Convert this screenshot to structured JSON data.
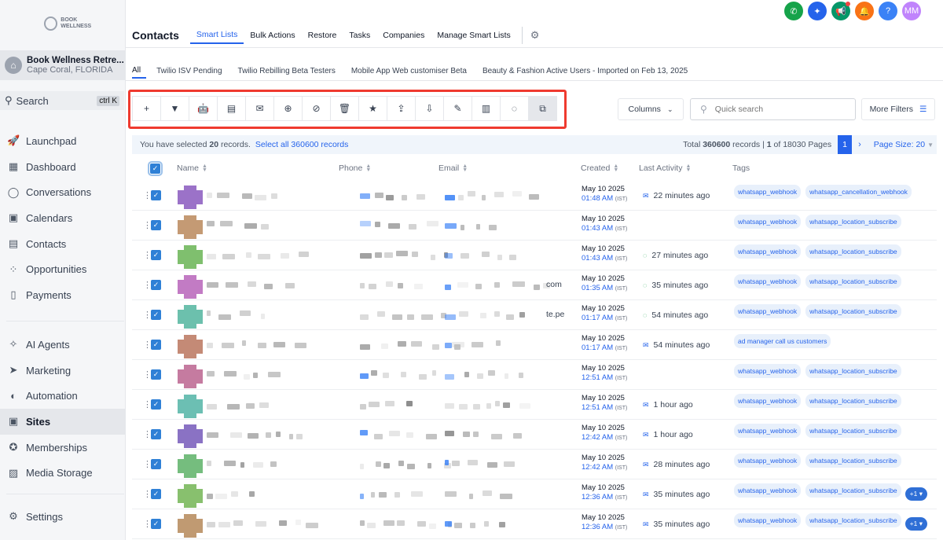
{
  "sidebar": {
    "logo_text": "BOOK WELLNESS",
    "location_name": "Book Wellness Retre...",
    "location_sub": "Cape Coral, FLORIDA",
    "search_label": "Search",
    "search_shortcut": "ctrl K",
    "items": [
      {
        "label": "Launchpad",
        "icon": "rocket-icon"
      },
      {
        "label": "Dashboard",
        "icon": "grid-icon"
      },
      {
        "label": "Conversations",
        "icon": "chat-icon"
      },
      {
        "label": "Calendars",
        "icon": "calendar-icon"
      },
      {
        "label": "Contacts",
        "icon": "contacts-icon"
      },
      {
        "label": "Opportunities",
        "icon": "funnel-icon"
      },
      {
        "label": "Payments",
        "icon": "receipt-icon"
      }
    ],
    "items2": [
      {
        "label": "AI Agents",
        "icon": "sparkle-icon"
      },
      {
        "label": "Marketing",
        "icon": "send-icon"
      },
      {
        "label": "Automation",
        "icon": "automation-icon"
      },
      {
        "label": "Sites",
        "icon": "sites-icon"
      },
      {
        "label": "Memberships",
        "icon": "membership-icon"
      },
      {
        "label": "Media Storage",
        "icon": "image-icon"
      }
    ],
    "settings_label": "Settings"
  },
  "header": {
    "avatar_initials": "MM",
    "title": "Contacts",
    "tabs": [
      "Smart Lists",
      "Bulk Actions",
      "Restore",
      "Tasks",
      "Companies",
      "Manage Smart Lists"
    ],
    "subtabs": [
      "All",
      "Twilio ISV Pending",
      "Twilio Rebilling Beta Testers",
      "Mobile App Web customiser Beta",
      "Beauty & Fashion Active Users - Imported on Feb 13, 2025"
    ]
  },
  "toolbar": {
    "columns_label": "Columns",
    "search_placeholder": "Quick search",
    "more_filters_label": "More Filters"
  },
  "selection": {
    "prefix": "You have selected",
    "count": "20",
    "suffix": "records.",
    "select_all": "Select all 360600 records",
    "total_prefix": "Total",
    "total": "360600",
    "total_suffix": "records |",
    "page": "1",
    "pages_suffix": "of 18030 Pages",
    "current_page": "1",
    "page_size": "Page Size: 20"
  },
  "columns": {
    "name": "Name",
    "phone": "Phone",
    "email": "Email",
    "created": "Created",
    "last_activity": "Last Activity",
    "tags": "Tags"
  },
  "rows": [
    {
      "date": "May 10 2025",
      "time": "01:48 AM",
      "tz": "(IST)",
      "activity": "22 minutes ago",
      "activity_icon": "email",
      "tags": [
        "whatsapp_webhook",
        "whatsapp_cancellation_webhook"
      ],
      "extra": "",
      "avatar_color": "#9b72c8"
    },
    {
      "date": "May 10 2025",
      "time": "01:43 AM",
      "tz": "(IST)",
      "activity": "",
      "activity_icon": "",
      "tags": [
        "whatsapp_webhook",
        "whatsapp_location_subscribe"
      ],
      "extra": "",
      "avatar_color": "#c49a74"
    },
    {
      "date": "May 10 2025",
      "time": "01:43 AM",
      "tz": "(IST)",
      "activity": "27 minutes ago",
      "activity_icon": "whatsapp",
      "tags": [
        "whatsapp_webhook",
        "whatsapp_location_subscribe"
      ],
      "extra": "",
      "avatar_color": "#7fbf6e"
    },
    {
      "date": "May 10 2025",
      "time": "01:35 AM",
      "tz": "(IST)",
      "activity": "35 minutes ago",
      "activity_icon": "whatsapp",
      "tags": [
        "whatsapp_webhook",
        "whatsapp_location_subscribe"
      ],
      "extra": "",
      "avatar_color": "#c27bc4",
      "trail": "com"
    },
    {
      "date": "May 10 2025",
      "time": "01:17 AM",
      "tz": "(IST)",
      "activity": "54 minutes ago",
      "activity_icon": "whatsapp",
      "tags": [
        "whatsapp_webhook",
        "whatsapp_location_subscribe"
      ],
      "extra": "",
      "avatar_color": "#6cc0ad",
      "trail": "te.pe"
    },
    {
      "date": "May 10 2025",
      "time": "01:17 AM",
      "tz": "(IST)",
      "activity": "54 minutes ago",
      "activity_icon": "email",
      "tags": [
        "ad manager call us customers"
      ],
      "extra": "",
      "avatar_color": "#c48a76"
    },
    {
      "date": "May 10 2025",
      "time": "12:51 AM",
      "tz": "(IST)",
      "activity": "",
      "activity_icon": "",
      "tags": [
        "whatsapp_webhook",
        "whatsapp_location_subscribe"
      ],
      "extra": "",
      "avatar_color": "#c57ba0"
    },
    {
      "date": "May 10 2025",
      "time": "12:51 AM",
      "tz": "(IST)",
      "activity": "1 hour ago",
      "activity_icon": "email",
      "tags": [
        "whatsapp_webhook",
        "whatsapp_location_subscribe"
      ],
      "extra": "",
      "avatar_color": "#6cbfb3"
    },
    {
      "date": "May 10 2025",
      "time": "12:42 AM",
      "tz": "(IST)",
      "activity": "1 hour ago",
      "activity_icon": "email",
      "tags": [
        "whatsapp_webhook",
        "whatsapp_location_subscribe"
      ],
      "extra": "",
      "avatar_color": "#8a72c4"
    },
    {
      "date": "May 10 2025",
      "time": "12:42 AM",
      "tz": "(IST)",
      "activity": "28 minutes ago",
      "activity_icon": "email",
      "tags": [
        "whatsapp_webhook",
        "whatsapp_location_subscribe"
      ],
      "extra": "",
      "avatar_color": "#75bd7e"
    },
    {
      "date": "May 10 2025",
      "time": "12:36 AM",
      "tz": "(IST)",
      "activity": "35 minutes ago",
      "activity_icon": "email",
      "tags": [
        "whatsapp_webhook",
        "whatsapp_location_subscribe"
      ],
      "extra": "+1",
      "avatar_color": "#88c06e"
    },
    {
      "date": "May 10 2025",
      "time": "12:36 AM",
      "tz": "(IST)",
      "activity": "35 minutes ago",
      "activity_icon": "email",
      "tags": [
        "whatsapp_webhook",
        "whatsapp_location_subscribe"
      ],
      "extra": "+1",
      "avatar_color": "#c09a72"
    }
  ],
  "colors": {
    "accent": "#2563eb",
    "highlight": "#ef3a2f"
  }
}
